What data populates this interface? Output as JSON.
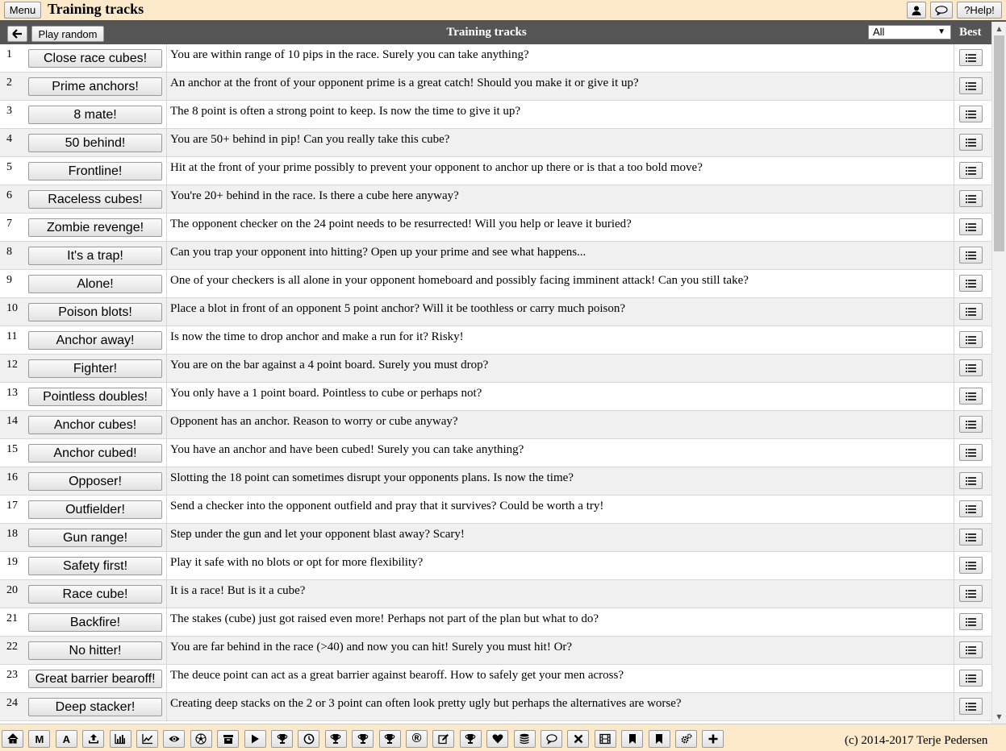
{
  "topbar": {
    "menu_label": "Menu",
    "app_title": "Training tracks",
    "help_label": "?Help!"
  },
  "header": {
    "title": "Training tracks",
    "play_random_label": "Play random",
    "filter_value": "All",
    "best_label": "Best"
  },
  "rows": [
    {
      "num": "1",
      "label": "Close race cubes!",
      "desc": "You are within range of 10 pips in the race. Surely you can take anything?"
    },
    {
      "num": "2",
      "label": "Prime anchors!",
      "desc": "An anchor at the front of your opponent prime is a great catch! Should you make it or give it up?"
    },
    {
      "num": "3",
      "label": "8 mate!",
      "desc": "The 8 point is often a strong point to keep. Is now the time to give it up?"
    },
    {
      "num": "4",
      "label": "50 behind!",
      "desc": "You are 50+ behind in pip! Can you really take this cube?"
    },
    {
      "num": "5",
      "label": "Frontline!",
      "desc": "Hit at the front of your prime possibly to prevent your opponent to anchor up there or is that a too bold move?"
    },
    {
      "num": "6",
      "label": "Raceless cubes!",
      "desc": "You're 20+ behind in the race. Is there a cube here anyway?"
    },
    {
      "num": "7",
      "label": "Zombie revenge!",
      "desc": "The opponent checker on the 24 point needs to be resurrected! Will you help or leave it buried?"
    },
    {
      "num": "8",
      "label": "It's a trap!",
      "desc": "Can you trap your opponent into hitting? Open up your prime and see what happens..."
    },
    {
      "num": "9",
      "label": "Alone!",
      "desc": "One of your checkers is all alone in your opponent homeboard and possibly facing imminent attack! Can you still take?"
    },
    {
      "num": "10",
      "label": "Poison blots!",
      "desc": "Place a blot in front of an opponent 5 point anchor? Will it be toothless or carry much poison?"
    },
    {
      "num": "11",
      "label": "Anchor away!",
      "desc": "Is now the time to drop anchor and make a run for it? Risky!"
    },
    {
      "num": "12",
      "label": "Fighter!",
      "desc": "You are on the bar against a 4 point board. Surely you must drop?"
    },
    {
      "num": "13",
      "label": "Pointless doubles!",
      "desc": "You only have a 1 point board. Pointless to cube or perhaps not?"
    },
    {
      "num": "14",
      "label": "Anchor cubes!",
      "desc": "Opponent has an anchor. Reason to worry or cube anyway?"
    },
    {
      "num": "15",
      "label": "Anchor cubed!",
      "desc": "You have an anchor and have been cubed! Surely you can take anything?"
    },
    {
      "num": "16",
      "label": "Opposer!",
      "desc": "Slotting the 18 point can sometimes disrupt your opponents plans. Is now the time?"
    },
    {
      "num": "17",
      "label": "Outfielder!",
      "desc": "Send a checker into the opponent outfield and pray that it survives? Could be worth a try!"
    },
    {
      "num": "18",
      "label": "Gun range!",
      "desc": "Step under the gun and let your opponent blast away? Scary!"
    },
    {
      "num": "19",
      "label": "Safety first!",
      "desc": "Play it safe with no blots or opt for more flexibility?"
    },
    {
      "num": "20",
      "label": "Race cube!",
      "desc": "It is a race! But is it a cube?"
    },
    {
      "num": "21",
      "label": "Backfire!",
      "desc": "The stakes (cube) just got raised even more! Perhaps not part of the plan but what to do?"
    },
    {
      "num": "22",
      "label": "No hitter!",
      "desc": "You are far behind in the race (>40) and now you can hit! Surely you must hit! Or?"
    },
    {
      "num": "23",
      "label": "Great barrier bearoff!",
      "desc": "The deuce point can act as a great barrier against bearoff. How to safely get your men across?"
    },
    {
      "num": "24",
      "label": "Deep stacker!",
      "desc": "Creating deep stacks on the 2 or 3 point can often look pretty ugly but perhaps the alternatives are worse?"
    }
  ],
  "toolbar": {
    "icons": [
      "home-icon",
      "m-icon",
      "a-icon",
      "upload-icon",
      "bar-chart-icon",
      "line-chart-icon",
      "eye-icon",
      "soccer-ball-icon",
      "archive-icon",
      "play-icon",
      "trophy-icon",
      "clock-icon",
      "trophy-icon",
      "trophy-icon",
      "trophy-icon",
      "registered-icon",
      "edit-icon",
      "trophy-icon",
      "heart-icon",
      "database-icon",
      "chat-icon",
      "close-icon",
      "film-icon",
      "bookmark-icon",
      "bookmark-icon",
      "cogs-icon",
      "plus-icon"
    ],
    "m_label": "M",
    "a_label": "A",
    "r_label": "®"
  },
  "footer": {
    "copyright": "(c) 2014-2017 Terje Pedersen"
  }
}
